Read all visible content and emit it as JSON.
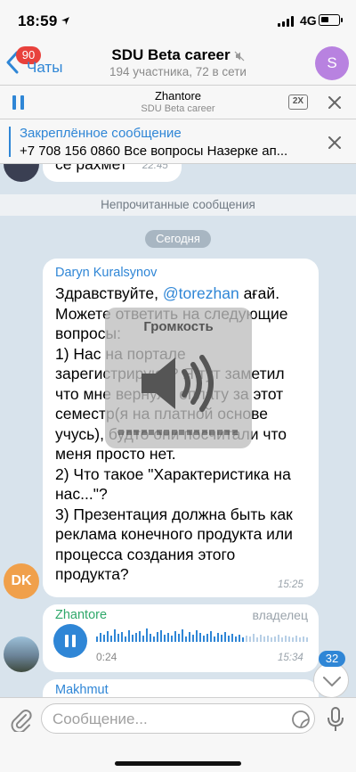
{
  "status_bar": {
    "time": "18:59",
    "network": "4G"
  },
  "header": {
    "back_label": "Чаты",
    "unread_badge": "90",
    "title": "SDU Beta career",
    "subtitle": "194 участника, 72 в сети",
    "avatar_letter": "S",
    "avatar_color": "#b882e0"
  },
  "player": {
    "title": "Zhantore",
    "subtitle": "SDU Beta career",
    "speed": "2X"
  },
  "pinned": {
    "title": "Закреплённое сообщение",
    "text": "+7 708 156 0860 Все вопросы Назерке ап..."
  },
  "chat": {
    "previous_message": {
      "text": "се рахмет",
      "time": "22:45"
    },
    "unread_divider": "Непрочитанные сообщения",
    "date_divider": "Сегодня",
    "message1": {
      "sender": "Daryn Kuralsynov",
      "sender_color": "#2f86d6",
      "text_before_mention": "Здравствуйте, ",
      "mention": "@torezhan",
      "text_after_mention": " ағай. Можете ответить на следующие вопросы:\n1) Нас на портале зарегистрируют? Я тут заметил что мне вернули оплату за этот семестр(я на платной основе учусь), будто они посчитали что меня просто нет.\n2) Что такое \"Характеристика на нас...\"?\n3) Презентация должна быть как реклама конечного продукта или процесса создания этого продукта?",
      "time": "15:25",
      "avatar_initials": "DK"
    },
    "message2": {
      "sender": "Zhantore",
      "sender_color": "#2fa86a",
      "role": "владелец",
      "duration": "0:24",
      "time": "15:34"
    },
    "message3": {
      "sender": "Makhmut"
    },
    "scroll_badge": "32"
  },
  "volume_hud": {
    "title": "Громкость",
    "level": 0.0
  },
  "input": {
    "placeholder": "Сообщение..."
  }
}
